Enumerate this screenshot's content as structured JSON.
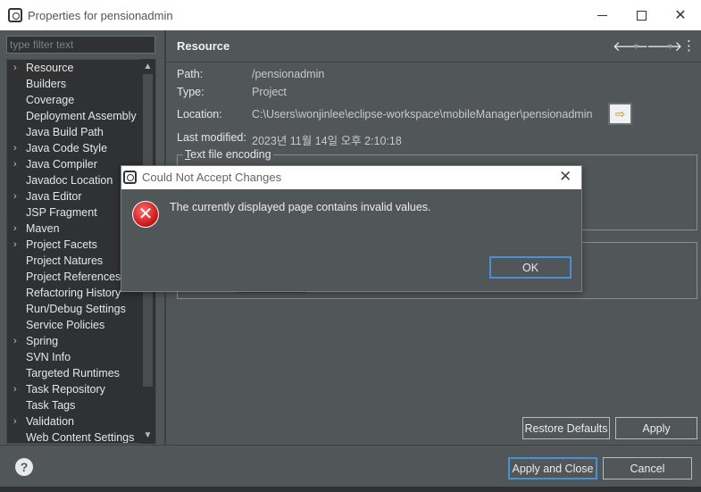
{
  "window": {
    "title": "Properties for pensionadmin"
  },
  "filter": {
    "placeholder": "type filter text"
  },
  "tree": [
    {
      "label": "Resource",
      "expandable": true
    },
    {
      "label": "Builders",
      "expandable": false
    },
    {
      "label": "Coverage",
      "expandable": false
    },
    {
      "label": "Deployment Assembly",
      "expandable": false
    },
    {
      "label": "Java Build Path",
      "expandable": false
    },
    {
      "label": "Java Code Style",
      "expandable": true
    },
    {
      "label": "Java Compiler",
      "expandable": true
    },
    {
      "label": "Javadoc Location",
      "expandable": false
    },
    {
      "label": "Java Editor",
      "expandable": true
    },
    {
      "label": "JSP Fragment",
      "expandable": false
    },
    {
      "label": "Maven",
      "expandable": true
    },
    {
      "label": "Project Facets",
      "expandable": true
    },
    {
      "label": "Project Natures",
      "expandable": false
    },
    {
      "label": "Project References",
      "expandable": false
    },
    {
      "label": "Refactoring History",
      "expandable": false
    },
    {
      "label": "Run/Debug Settings",
      "expandable": false
    },
    {
      "label": "Service Policies",
      "expandable": false
    },
    {
      "label": "Spring",
      "expandable": true
    },
    {
      "label": "SVN Info",
      "expandable": false
    },
    {
      "label": "Targeted Runtimes",
      "expandable": false
    },
    {
      "label": "Task Repository",
      "expandable": true
    },
    {
      "label": "Task Tags",
      "expandable": false
    },
    {
      "label": "Validation",
      "expandable": true
    },
    {
      "label": "Web Content Settings",
      "expandable": false
    }
  ],
  "page": {
    "title": "Resource",
    "path_label": "Path:",
    "path_value": "/pensionadmin",
    "type_label": "Type:",
    "type_value": "Project",
    "location_label": "Location:",
    "location_value": "C:\\Users\\wonjinlee\\eclipse-workspace\\mobileManager\\pensionadmin",
    "modified_label": "Last modified:",
    "modified_value": "2023년 11월 14일 오후 2:10:18",
    "encoding_group_prefix": "T",
    "encoding_group_rest": "ext file encoding"
  },
  "buttons": {
    "restore_defaults": "Restore Defaults",
    "apply": "Apply",
    "apply_and_close": "Apply and Close",
    "cancel": "Cancel"
  },
  "dialog": {
    "title": "Could Not Accept Changes",
    "message": "The currently displayed page contains invalid values.",
    "ok": "OK"
  },
  "icons": {
    "help": "?",
    "close": "✕",
    "back": "🡐",
    "forward": "🡒",
    "menu": "⋮",
    "error": "✕"
  },
  "colors": {
    "background": "#515658",
    "tree_background": "#2f3133",
    "focus_accent": "#4a90d9",
    "error_red": "#c41515"
  }
}
